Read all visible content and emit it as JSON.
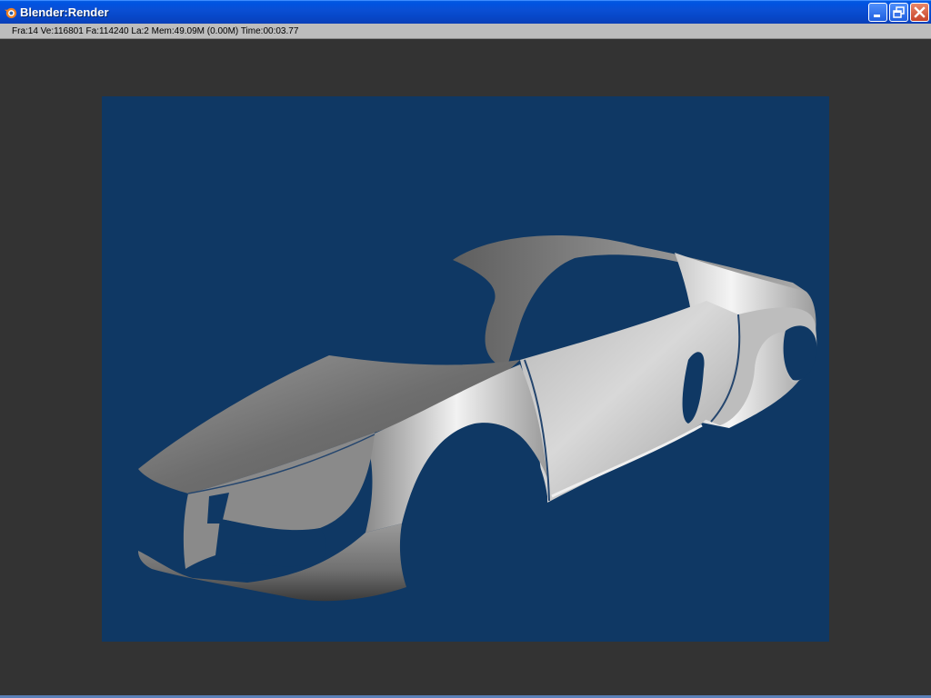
{
  "window": {
    "title": "Blender:Render",
    "icon": "blender-logo-icon",
    "controls": [
      "minimize-icon",
      "restore-icon",
      "close-icon"
    ]
  },
  "status": {
    "text": "Fra:14  Ve:116801  Fa:114240  La:2  Mem:49.09M (0.00M)  Time:00:03.77"
  },
  "colors": {
    "render_background": "#0f3864",
    "viewport_background": "#333333",
    "titlebar": "#0a4fd4",
    "statusbar": "#bdbdbd"
  }
}
